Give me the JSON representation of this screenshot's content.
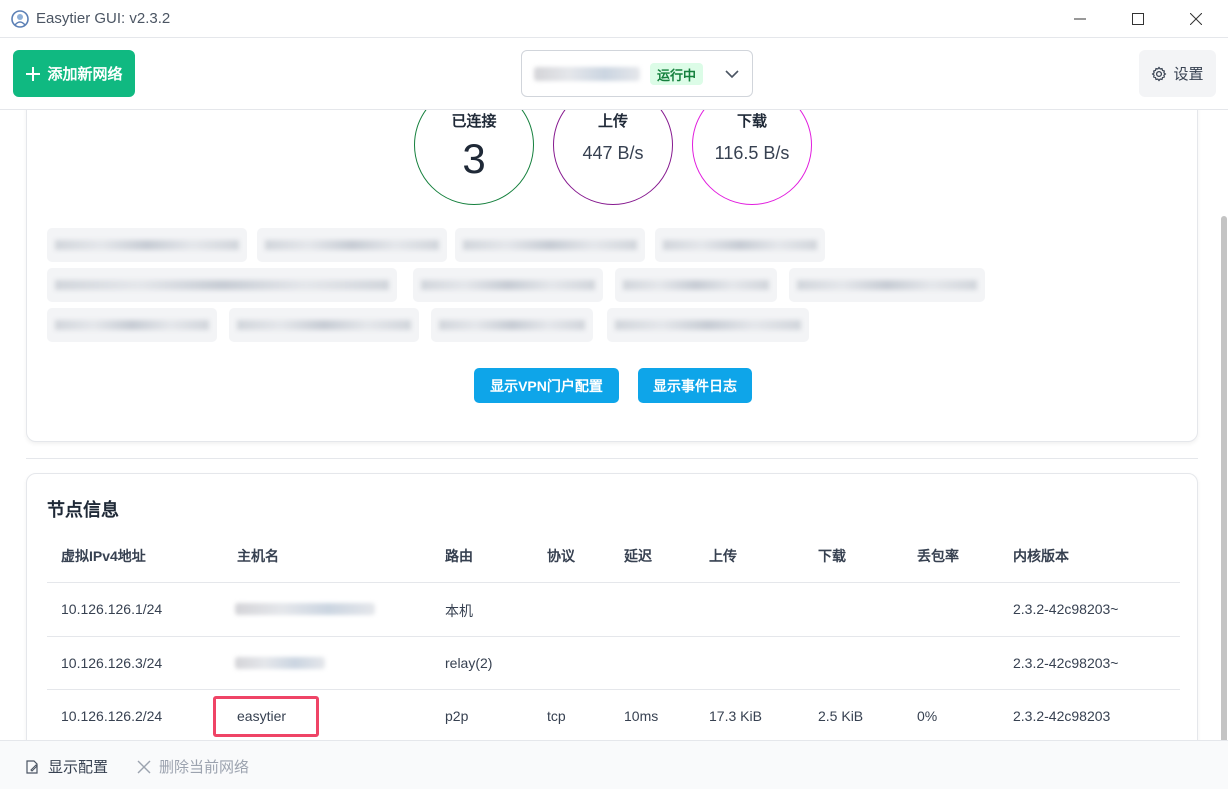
{
  "window": {
    "title": "Easytier GUI: v2.3.2"
  },
  "toolbar": {
    "add_network_label": "添加新网络",
    "network_status": "运行中",
    "settings_label": "设置"
  },
  "stats": {
    "connected_label": "已连接",
    "connected_value": "3",
    "upload_label": "上传",
    "upload_value": "447 B/s",
    "download_label": "下载",
    "download_value": "116.5 B/s"
  },
  "actions": {
    "show_vpn_portal": "显示VPN门户配置",
    "show_event_log": "显示事件日志"
  },
  "nodes": {
    "title": "节点信息",
    "columns": [
      "虚拟IPv4地址",
      "主机名",
      "路由",
      "协议",
      "延迟",
      "上传",
      "下载",
      "丢包率",
      "内核版本"
    ],
    "rows": [
      {
        "ipv4": "10.126.126.1/24",
        "hostname": "",
        "route": "本机",
        "protocol": "",
        "latency": "",
        "upload": "",
        "download": "",
        "loss": "",
        "version": "2.3.2-42c98203~"
      },
      {
        "ipv4": "10.126.126.3/24",
        "hostname": "",
        "route": "relay(2)",
        "protocol": "",
        "latency": "",
        "upload": "",
        "download": "",
        "loss": "",
        "version": "2.3.2-42c98203~"
      },
      {
        "ipv4": "10.126.126.2/24",
        "hostname": "easytier",
        "route": "p2p",
        "protocol": "tcp",
        "latency": "10ms",
        "upload": "17.3 KiB",
        "download": "2.5 KiB",
        "loss": "0%",
        "version": "2.3.2-42c98203"
      }
    ]
  },
  "bottombar": {
    "show_config": "显示配置",
    "delete_network": "删除当前网络"
  },
  "colors": {
    "primary_green": "#10b981",
    "accent_blue": "#0ea5e9",
    "status_green": "#15803d",
    "highlight_red": "#ef4466"
  }
}
